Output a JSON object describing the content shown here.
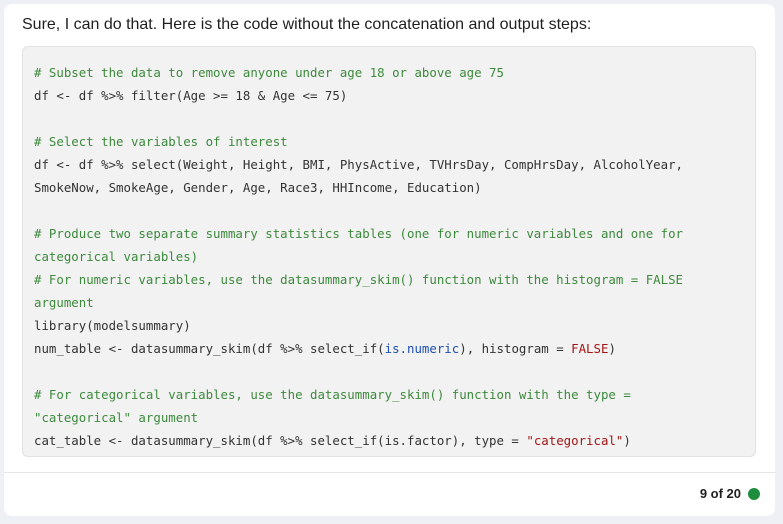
{
  "message": {
    "intro": "Sure, I can do that. Here is the code without the concatenation and output steps:"
  },
  "code": {
    "line1": "# Subset the data to remove anyone under age 18 or above age 75",
    "line2": "df <- df %>% filter(Age >= 18 & Age <= 75)",
    "line3": "# Select the variables of interest",
    "line4": "df <- df %>% select(Weight, Height, BMI, PhysActive, TVHrsDay, CompHrsDay, AlcoholYear,",
    "line5": "SmokeNow, SmokeAge, Gender, Age, Race3, HHIncome, Education)",
    "line6": "# Produce two separate summary statistics tables (one for numeric variables and one for",
    "line7": "categorical variables)",
    "line8": "# For numeric variables, use the datasummary_skim() function with the histogram = FALSE",
    "line9": "argument",
    "line10": "library(modelsummary)",
    "line11": {
      "a": "num_table <- datasummary_skim(df %>% select_if(",
      "b": "is.numeric",
      "c": "), histogram = ",
      "d": "FALSE",
      "e": ")"
    },
    "line12": "# For categorical variables, use the datasummary_skim() function with the type =",
    "line13": "\"categorical\" argument",
    "line14": {
      "a": "cat_table <- datasummary_skim(df %>% select_if(is.factor), type = ",
      "b": "\"categorical\"",
      "c": ")"
    }
  },
  "footer": {
    "counter": "9 of 20",
    "status_color": "#1e8e3e"
  },
  "colors": {
    "comment": "#3d8a3d",
    "string": "#a31515",
    "keyword": "#1c4fb0"
  }
}
